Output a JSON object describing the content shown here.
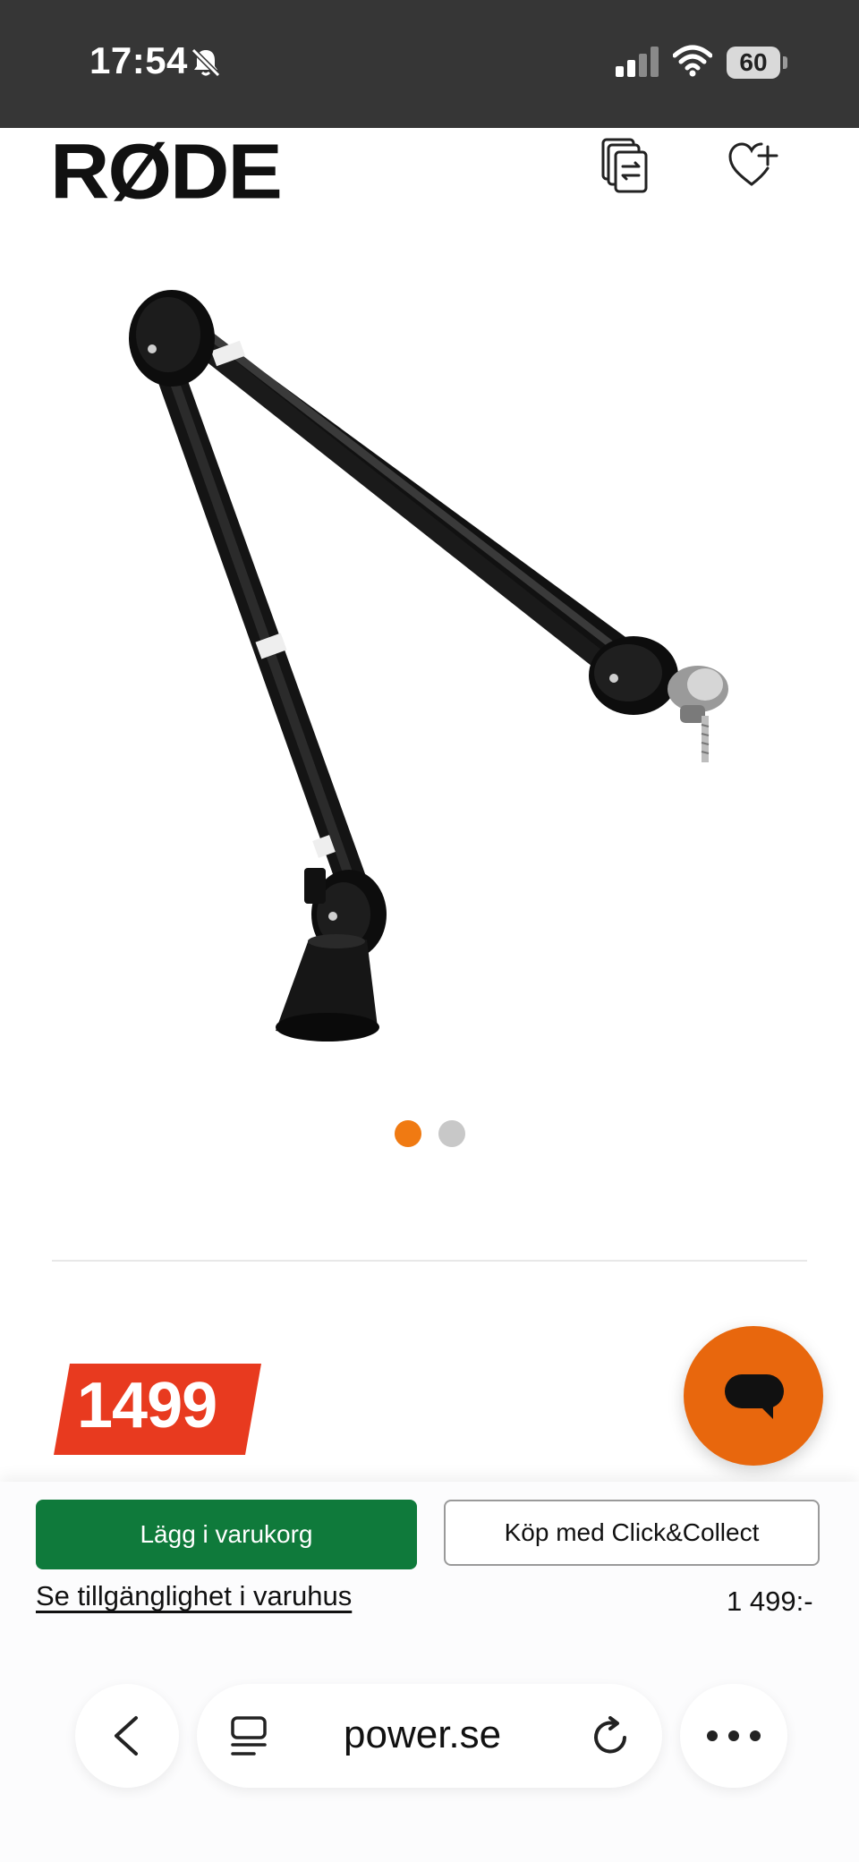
{
  "status_bar": {
    "time": "17:54",
    "battery": "60",
    "icons": [
      "bell-muted-icon",
      "signal-icon",
      "wifi-icon",
      "battery-icon"
    ]
  },
  "header": {
    "brand": "RØDE",
    "icons": [
      "compare-icon",
      "wishlist-add-icon"
    ]
  },
  "gallery": {
    "image": "boom-arm-product-image",
    "current_slide": 1,
    "slide_count": 2
  },
  "price": {
    "badge": "1499",
    "formatted": "1 499:-"
  },
  "actions": {
    "add_to_cart": "Lägg i varukorg",
    "click_collect": "Köp med Click&Collect",
    "availability_link": "Se tillgänglighet i varuhus"
  },
  "chat": {
    "icon": "chat-bubble-icon"
  },
  "browser": {
    "url": "power.se",
    "icons": [
      "back-icon",
      "tabs-icon",
      "reload-icon",
      "more-icon"
    ]
  },
  "colors": {
    "accent_orange": "#e8670d",
    "price_red": "#e83a1f",
    "cart_green": "#0f7a3b",
    "status_bar": "#363636"
  }
}
